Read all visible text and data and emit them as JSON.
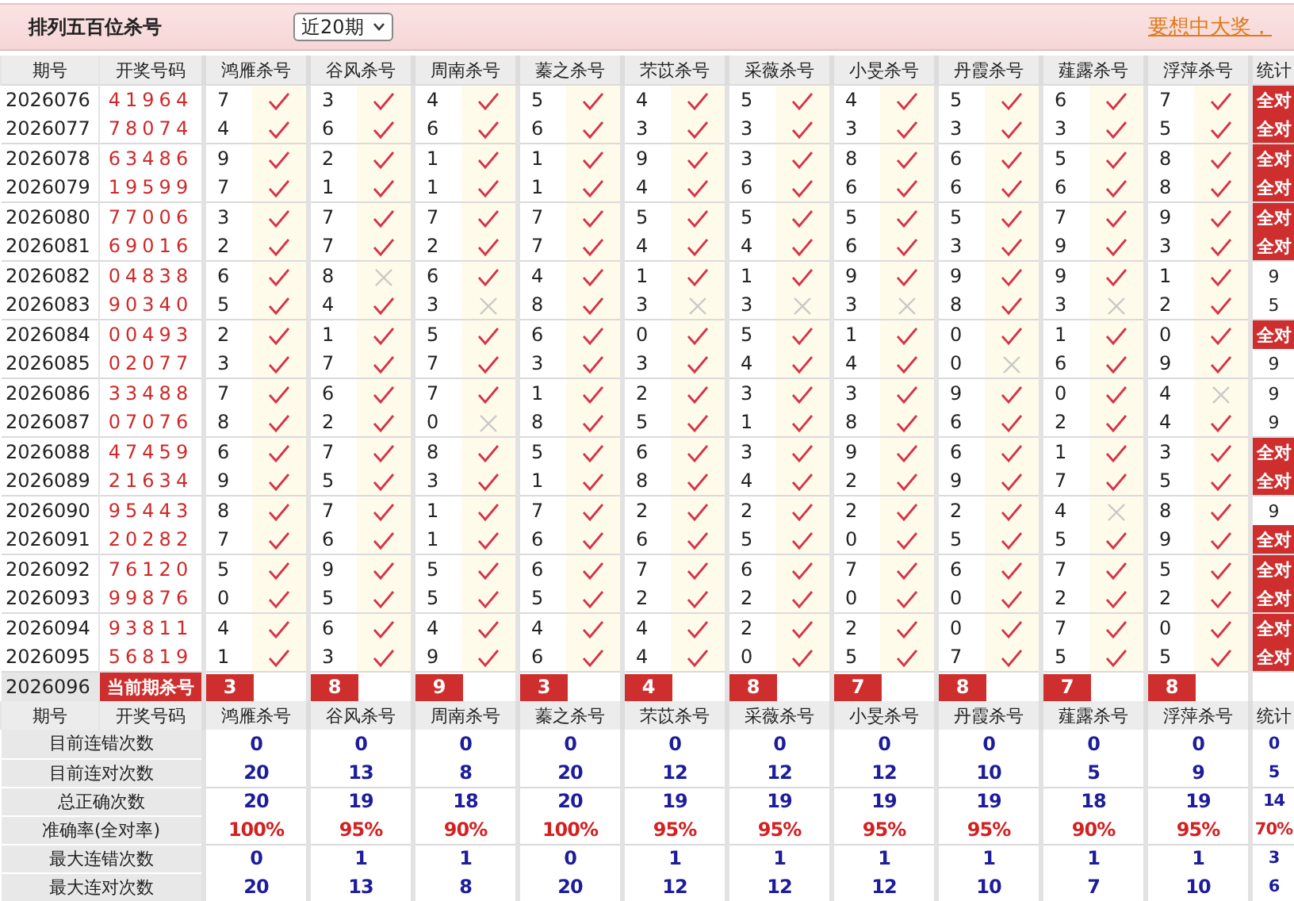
{
  "header": {
    "title": "排列五百位杀号",
    "range_select": "近20期",
    "promo_link": "要想中大奖，"
  },
  "columns": {
    "period": "期号",
    "number": "开奖号码",
    "experts": [
      "鸿雁杀号",
      "谷风杀号",
      "周南杀号",
      "蓁之杀号",
      "芣苡杀号",
      "采薇杀号",
      "小旻杀号",
      "丹霞杀号",
      "薤露杀号",
      "浮萍杀号"
    ],
    "stat": "统计"
  },
  "rows": [
    {
      "period": "2026076",
      "number": "41964",
      "kills": [
        {
          "value": "7",
          "hit": true
        },
        {
          "value": "3",
          "hit": true
        },
        {
          "value": "4",
          "hit": true
        },
        {
          "value": "5",
          "hit": true
        },
        {
          "value": "4",
          "hit": true
        },
        {
          "value": "5",
          "hit": true
        },
        {
          "value": "4",
          "hit": true
        },
        {
          "value": "5",
          "hit": true
        },
        {
          "value": "6",
          "hit": true
        },
        {
          "value": "7",
          "hit": true
        }
      ],
      "stat": "全对",
      "all_correct": true
    },
    {
      "period": "2026077",
      "number": "78074",
      "kills": [
        {
          "value": "4",
          "hit": true
        },
        {
          "value": "6",
          "hit": true
        },
        {
          "value": "6",
          "hit": true
        },
        {
          "value": "6",
          "hit": true
        },
        {
          "value": "3",
          "hit": true
        },
        {
          "value": "3",
          "hit": true
        },
        {
          "value": "3",
          "hit": true
        },
        {
          "value": "3",
          "hit": true
        },
        {
          "value": "3",
          "hit": true
        },
        {
          "value": "5",
          "hit": true
        }
      ],
      "stat": "全对",
      "all_correct": true
    },
    {
      "period": "2026078",
      "number": "63486",
      "kills": [
        {
          "value": "9",
          "hit": true
        },
        {
          "value": "2",
          "hit": true
        },
        {
          "value": "1",
          "hit": true
        },
        {
          "value": "1",
          "hit": true
        },
        {
          "value": "9",
          "hit": true
        },
        {
          "value": "3",
          "hit": true
        },
        {
          "value": "8",
          "hit": true
        },
        {
          "value": "6",
          "hit": true
        },
        {
          "value": "5",
          "hit": true
        },
        {
          "value": "8",
          "hit": true
        }
      ],
      "stat": "全对",
      "all_correct": true
    },
    {
      "period": "2026079",
      "number": "19599",
      "kills": [
        {
          "value": "7",
          "hit": true
        },
        {
          "value": "1",
          "hit": true
        },
        {
          "value": "1",
          "hit": true
        },
        {
          "value": "1",
          "hit": true
        },
        {
          "value": "4",
          "hit": true
        },
        {
          "value": "6",
          "hit": true
        },
        {
          "value": "6",
          "hit": true
        },
        {
          "value": "6",
          "hit": true
        },
        {
          "value": "6",
          "hit": true
        },
        {
          "value": "8",
          "hit": true
        }
      ],
      "stat": "全对",
      "all_correct": true
    },
    {
      "period": "2026080",
      "number": "77006",
      "kills": [
        {
          "value": "3",
          "hit": true
        },
        {
          "value": "7",
          "hit": true
        },
        {
          "value": "7",
          "hit": true
        },
        {
          "value": "7",
          "hit": true
        },
        {
          "value": "5",
          "hit": true
        },
        {
          "value": "5",
          "hit": true
        },
        {
          "value": "5",
          "hit": true
        },
        {
          "value": "5",
          "hit": true
        },
        {
          "value": "7",
          "hit": true
        },
        {
          "value": "9",
          "hit": true
        }
      ],
      "stat": "全对",
      "all_correct": true
    },
    {
      "period": "2026081",
      "number": "69016",
      "kills": [
        {
          "value": "2",
          "hit": true
        },
        {
          "value": "7",
          "hit": true
        },
        {
          "value": "2",
          "hit": true
        },
        {
          "value": "7",
          "hit": true
        },
        {
          "value": "4",
          "hit": true
        },
        {
          "value": "4",
          "hit": true
        },
        {
          "value": "6",
          "hit": true
        },
        {
          "value": "3",
          "hit": true
        },
        {
          "value": "9",
          "hit": true
        },
        {
          "value": "3",
          "hit": true
        }
      ],
      "stat": "全对",
      "all_correct": true
    },
    {
      "period": "2026082",
      "number": "04838",
      "kills": [
        {
          "value": "6",
          "hit": true
        },
        {
          "value": "8",
          "hit": false
        },
        {
          "value": "6",
          "hit": true
        },
        {
          "value": "4",
          "hit": true
        },
        {
          "value": "1",
          "hit": true
        },
        {
          "value": "1",
          "hit": true
        },
        {
          "value": "9",
          "hit": true
        },
        {
          "value": "9",
          "hit": true
        },
        {
          "value": "9",
          "hit": true
        },
        {
          "value": "1",
          "hit": true
        }
      ],
      "stat": "9",
      "all_correct": false
    },
    {
      "period": "2026083",
      "number": "90340",
      "kills": [
        {
          "value": "5",
          "hit": true
        },
        {
          "value": "4",
          "hit": true
        },
        {
          "value": "3",
          "hit": false
        },
        {
          "value": "8",
          "hit": true
        },
        {
          "value": "3",
          "hit": false
        },
        {
          "value": "3",
          "hit": false
        },
        {
          "value": "3",
          "hit": false
        },
        {
          "value": "8",
          "hit": true
        },
        {
          "value": "3",
          "hit": false
        },
        {
          "value": "2",
          "hit": true
        }
      ],
      "stat": "5",
      "all_correct": false
    },
    {
      "period": "2026084",
      "number": "00493",
      "kills": [
        {
          "value": "2",
          "hit": true
        },
        {
          "value": "1",
          "hit": true
        },
        {
          "value": "5",
          "hit": true
        },
        {
          "value": "6",
          "hit": true
        },
        {
          "value": "0",
          "hit": true
        },
        {
          "value": "5",
          "hit": true
        },
        {
          "value": "1",
          "hit": true
        },
        {
          "value": "0",
          "hit": true
        },
        {
          "value": "1",
          "hit": true
        },
        {
          "value": "0",
          "hit": true
        }
      ],
      "stat": "全对",
      "all_correct": true
    },
    {
      "period": "2026085",
      "number": "02077",
      "kills": [
        {
          "value": "3",
          "hit": true
        },
        {
          "value": "7",
          "hit": true
        },
        {
          "value": "7",
          "hit": true
        },
        {
          "value": "3",
          "hit": true
        },
        {
          "value": "3",
          "hit": true
        },
        {
          "value": "4",
          "hit": true
        },
        {
          "value": "4",
          "hit": true
        },
        {
          "value": "0",
          "hit": false
        },
        {
          "value": "6",
          "hit": true
        },
        {
          "value": "9",
          "hit": true
        }
      ],
      "stat": "9",
      "all_correct": false
    },
    {
      "period": "2026086",
      "number": "33488",
      "kills": [
        {
          "value": "7",
          "hit": true
        },
        {
          "value": "6",
          "hit": true
        },
        {
          "value": "7",
          "hit": true
        },
        {
          "value": "1",
          "hit": true
        },
        {
          "value": "2",
          "hit": true
        },
        {
          "value": "3",
          "hit": true
        },
        {
          "value": "3",
          "hit": true
        },
        {
          "value": "9",
          "hit": true
        },
        {
          "value": "0",
          "hit": true
        },
        {
          "value": "4",
          "hit": false
        }
      ],
      "stat": "9",
      "all_correct": false
    },
    {
      "period": "2026087",
      "number": "07076",
      "kills": [
        {
          "value": "8",
          "hit": true
        },
        {
          "value": "2",
          "hit": true
        },
        {
          "value": "0",
          "hit": false
        },
        {
          "value": "8",
          "hit": true
        },
        {
          "value": "5",
          "hit": true
        },
        {
          "value": "1",
          "hit": true
        },
        {
          "value": "8",
          "hit": true
        },
        {
          "value": "6",
          "hit": true
        },
        {
          "value": "2",
          "hit": true
        },
        {
          "value": "4",
          "hit": true
        }
      ],
      "stat": "9",
      "all_correct": false
    },
    {
      "period": "2026088",
      "number": "47459",
      "kills": [
        {
          "value": "6",
          "hit": true
        },
        {
          "value": "7",
          "hit": true
        },
        {
          "value": "8",
          "hit": true
        },
        {
          "value": "5",
          "hit": true
        },
        {
          "value": "6",
          "hit": true
        },
        {
          "value": "3",
          "hit": true
        },
        {
          "value": "9",
          "hit": true
        },
        {
          "value": "6",
          "hit": true
        },
        {
          "value": "1",
          "hit": true
        },
        {
          "value": "3",
          "hit": true
        }
      ],
      "stat": "全对",
      "all_correct": true
    },
    {
      "period": "2026089",
      "number": "21634",
      "kills": [
        {
          "value": "9",
          "hit": true
        },
        {
          "value": "5",
          "hit": true
        },
        {
          "value": "3",
          "hit": true
        },
        {
          "value": "1",
          "hit": true
        },
        {
          "value": "8",
          "hit": true
        },
        {
          "value": "4",
          "hit": true
        },
        {
          "value": "2",
          "hit": true
        },
        {
          "value": "9",
          "hit": true
        },
        {
          "value": "7",
          "hit": true
        },
        {
          "value": "5",
          "hit": true
        }
      ],
      "stat": "全对",
      "all_correct": true
    },
    {
      "period": "2026090",
      "number": "95443",
      "kills": [
        {
          "value": "8",
          "hit": true
        },
        {
          "value": "7",
          "hit": true
        },
        {
          "value": "1",
          "hit": true
        },
        {
          "value": "7",
          "hit": true
        },
        {
          "value": "2",
          "hit": true
        },
        {
          "value": "2",
          "hit": true
        },
        {
          "value": "2",
          "hit": true
        },
        {
          "value": "2",
          "hit": true
        },
        {
          "value": "4",
          "hit": false
        },
        {
          "value": "8",
          "hit": true
        }
      ],
      "stat": "9",
      "all_correct": false
    },
    {
      "period": "2026091",
      "number": "20282",
      "kills": [
        {
          "value": "7",
          "hit": true
        },
        {
          "value": "6",
          "hit": true
        },
        {
          "value": "1",
          "hit": true
        },
        {
          "value": "6",
          "hit": true
        },
        {
          "value": "6",
          "hit": true
        },
        {
          "value": "5",
          "hit": true
        },
        {
          "value": "0",
          "hit": true
        },
        {
          "value": "5",
          "hit": true
        },
        {
          "value": "5",
          "hit": true
        },
        {
          "value": "9",
          "hit": true
        }
      ],
      "stat": "全对",
      "all_correct": true
    },
    {
      "period": "2026092",
      "number": "76120",
      "kills": [
        {
          "value": "5",
          "hit": true
        },
        {
          "value": "9",
          "hit": true
        },
        {
          "value": "5",
          "hit": true
        },
        {
          "value": "6",
          "hit": true
        },
        {
          "value": "7",
          "hit": true
        },
        {
          "value": "6",
          "hit": true
        },
        {
          "value": "7",
          "hit": true
        },
        {
          "value": "6",
          "hit": true
        },
        {
          "value": "7",
          "hit": true
        },
        {
          "value": "5",
          "hit": true
        }
      ],
      "stat": "全对",
      "all_correct": true
    },
    {
      "period": "2026093",
      "number": "99876",
      "kills": [
        {
          "value": "0",
          "hit": true
        },
        {
          "value": "5",
          "hit": true
        },
        {
          "value": "5",
          "hit": true
        },
        {
          "value": "5",
          "hit": true
        },
        {
          "value": "2",
          "hit": true
        },
        {
          "value": "2",
          "hit": true
        },
        {
          "value": "0",
          "hit": true
        },
        {
          "value": "0",
          "hit": true
        },
        {
          "value": "2",
          "hit": true
        },
        {
          "value": "2",
          "hit": true
        }
      ],
      "stat": "全对",
      "all_correct": true
    },
    {
      "period": "2026094",
      "number": "93811",
      "kills": [
        {
          "value": "4",
          "hit": true
        },
        {
          "value": "6",
          "hit": true
        },
        {
          "value": "4",
          "hit": true
        },
        {
          "value": "4",
          "hit": true
        },
        {
          "value": "4",
          "hit": true
        },
        {
          "value": "2",
          "hit": true
        },
        {
          "value": "2",
          "hit": true
        },
        {
          "value": "0",
          "hit": true
        },
        {
          "value": "7",
          "hit": true
        },
        {
          "value": "0",
          "hit": true
        }
      ],
      "stat": "全对",
      "all_correct": true
    },
    {
      "period": "2026095",
      "number": "56819",
      "kills": [
        {
          "value": "1",
          "hit": true
        },
        {
          "value": "3",
          "hit": true
        },
        {
          "value": "9",
          "hit": true
        },
        {
          "value": "6",
          "hit": true
        },
        {
          "value": "4",
          "hit": true
        },
        {
          "value": "0",
          "hit": true
        },
        {
          "value": "5",
          "hit": true
        },
        {
          "value": "7",
          "hit": true
        },
        {
          "value": "5",
          "hit": true
        },
        {
          "value": "5",
          "hit": true
        }
      ],
      "stat": "全对",
      "all_correct": true
    }
  ],
  "current": {
    "period": "2026096",
    "label": "当前期杀号",
    "kills": [
      "3",
      "8",
      "9",
      "3",
      "4",
      "8",
      "7",
      "8",
      "7",
      "8"
    ]
  },
  "summary_columns": {
    "period": "期号",
    "number": "开奖号码",
    "experts": [
      "鸿雁杀号",
      "谷风杀号",
      "周南杀号",
      "蓁之杀号",
      "芣苡杀号",
      "采薇杀号",
      "小旻杀号",
      "丹霞杀号",
      "薤露杀号",
      "浮萍杀号"
    ],
    "stat": "统计"
  },
  "summary": [
    {
      "label": "目前连错次数",
      "kind": "count",
      "values": [
        "0",
        "0",
        "0",
        "0",
        "0",
        "0",
        "0",
        "0",
        "0",
        "0",
        "0"
      ]
    },
    {
      "label": "目前连对次数",
      "kind": "count",
      "values": [
        "20",
        "13",
        "8",
        "20",
        "12",
        "12",
        "12",
        "10",
        "5",
        "9",
        "5"
      ]
    },
    {
      "label": "总正确次数",
      "kind": "count",
      "values": [
        "20",
        "19",
        "18",
        "20",
        "19",
        "19",
        "19",
        "19",
        "18",
        "19",
        "14"
      ]
    },
    {
      "label": "准确率(全对率)",
      "kind": "percent",
      "values": [
        "100%",
        "95%",
        "90%",
        "100%",
        "95%",
        "95%",
        "95%",
        "95%",
        "90%",
        "95%",
        "70%"
      ]
    },
    {
      "label": "最大连错次数",
      "kind": "count",
      "values": [
        "0",
        "1",
        "1",
        "0",
        "1",
        "1",
        "1",
        "1",
        "1",
        "1",
        "3"
      ]
    },
    {
      "label": "最大连对次数",
      "kind": "count",
      "values": [
        "20",
        "13",
        "8",
        "20",
        "12",
        "12",
        "12",
        "10",
        "7",
        "10",
        "6"
      ]
    }
  ]
}
